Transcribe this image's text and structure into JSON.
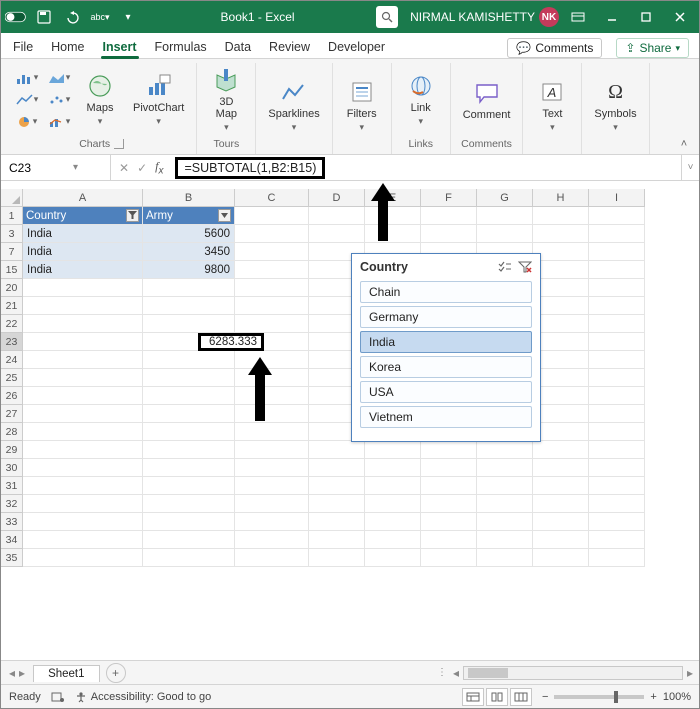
{
  "titlebar": {
    "doc_title": "Book1 - Excel",
    "user_name": "NIRMAL KAMISHETTY",
    "user_initials": "NK"
  },
  "tabs": {
    "items": [
      "File",
      "Home",
      "Insert",
      "Formulas",
      "Data",
      "Review",
      "Developer"
    ],
    "active_index": 2,
    "comments_btn": "Comments",
    "share_btn": "Share"
  },
  "ribbon": {
    "groups": {
      "charts": "Charts",
      "tours": "Tours",
      "links": "Links",
      "comments": "Comments"
    },
    "buttons": {
      "maps": "Maps",
      "pivotchart": "PivotChart",
      "map3d": "3D\nMap",
      "sparklines": "Sparklines",
      "filters": "Filters",
      "link": "Link",
      "comment": "Comment",
      "text": "Text",
      "symbols": "Symbols"
    }
  },
  "namebox": {
    "value": "C23"
  },
  "formula": {
    "value": "=SUBTOTAL(1,B2:B15)"
  },
  "columns": [
    "A",
    "B",
    "C",
    "D",
    "E",
    "F",
    "G",
    "H",
    "I"
  ],
  "header_row": {
    "country": "Country",
    "army": "Army"
  },
  "data_rows": [
    {
      "rownum": "3",
      "country": "India",
      "army": "5600"
    },
    {
      "rownum": "7",
      "country": "India",
      "army": "3450"
    },
    {
      "rownum": "15",
      "country": "India",
      "army": "9800"
    }
  ],
  "blank_rownums": [
    "20",
    "21",
    "22",
    "23",
    "24",
    "25",
    "26",
    "27",
    "28",
    "29",
    "30",
    "31",
    "32",
    "33",
    "34",
    "35"
  ],
  "result": {
    "rownum": "23",
    "value": "6283.333"
  },
  "slicer": {
    "title": "Country",
    "items": [
      "Chain",
      "Germany",
      "India",
      "Korea",
      "USA",
      "Vietnem"
    ],
    "selected_index": 2
  },
  "sheet_tab": "Sheet1",
  "status": {
    "state": "Ready",
    "accessibility": "Accessibility: Good to go",
    "zoom": "100%"
  }
}
